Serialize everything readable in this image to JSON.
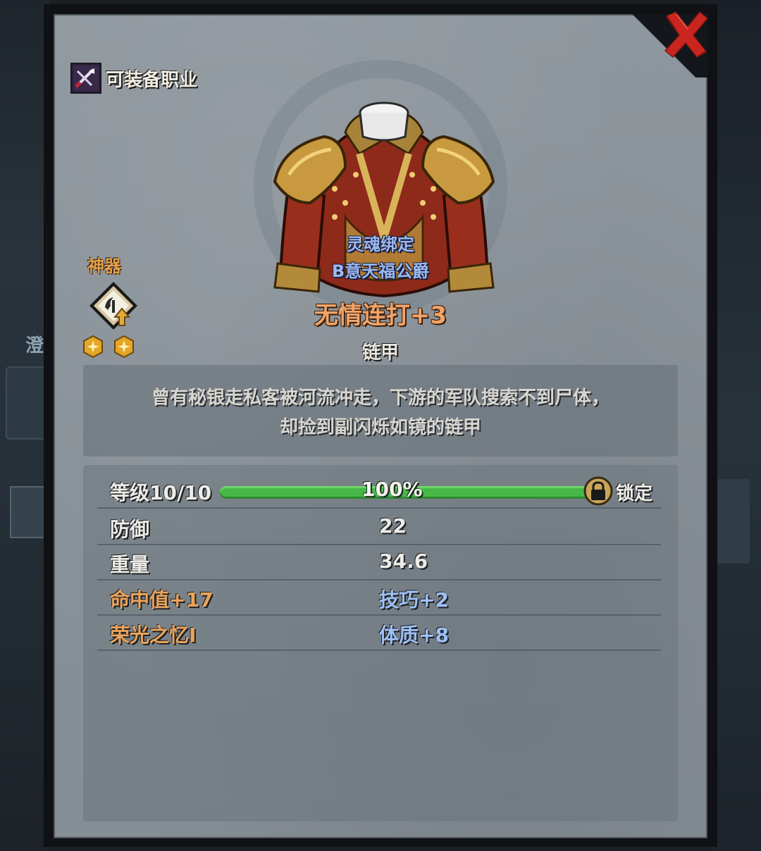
{
  "background": {
    "left_fragment_text": "澄"
  },
  "header": {
    "class_label": "可装备职业"
  },
  "artifact": {
    "label": "神器",
    "stars": 2
  },
  "item": {
    "soulbound_line1": "灵魂绑定",
    "soulbound_line2": "B意天福公爵",
    "name": "无情连打+3",
    "type": "链甲",
    "description_line1": "曾有秘银走私客被河流冲走，下游的军队搜索不到尸体，",
    "description_line2": "却捡到副闪烁如镜的链甲"
  },
  "stats": {
    "level_label": "等级10/10",
    "level_percent_text": "100%",
    "level_progress": 1.0,
    "lock_label": "锁定",
    "rows": [
      {
        "label": "防御",
        "value": "22"
      },
      {
        "label": "重量",
        "value": "34.6"
      },
      {
        "label": "命中值+17",
        "value": "技巧+2"
      },
      {
        "label": "荣光之忆I",
        "value": "体质+8"
      }
    ]
  },
  "colors": {
    "item_name": "#f0a46a",
    "soulbound": "#9bb8f2",
    "bonus_blue": "#9fc0f4",
    "accent_orange": "#eba35a",
    "level_bar": "#47b847",
    "close_red": "#c8261e"
  },
  "icons": {
    "close": "close-x-icon",
    "class": "class-crossed-weapons-icon",
    "artifact": "artifact-upgrade-icon",
    "star": "gold-star-icon",
    "lock": "padlock-icon"
  }
}
